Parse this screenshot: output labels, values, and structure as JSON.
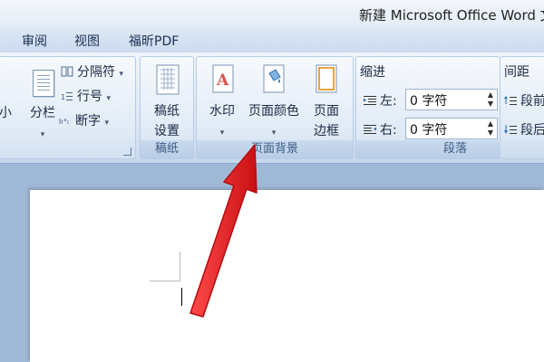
{
  "window": {
    "title": "新建 Microsoft Office Word 文"
  },
  "tabs": [
    {
      "label": "审阅"
    },
    {
      "label": "视图"
    },
    {
      "label": "福昕PDF"
    }
  ],
  "page_setup": {
    "small_label": "小",
    "columns_label": "分栏",
    "breaks_label": "分隔符",
    "line_numbers_label": "行号",
    "hyphenation_label": "断字"
  },
  "draft_paper": {
    "button_line1": "稿纸",
    "button_line2": "设置",
    "group_label": "稿纸"
  },
  "page_background": {
    "watermark_label": "水印",
    "page_color_label": "页面颜色",
    "page_border_line1": "页面",
    "page_border_line2": "边框",
    "group_label": "页面背景"
  },
  "paragraph": {
    "indent_label": "缩进",
    "left_label": "左:",
    "left_value": "0 字符",
    "right_label": "右:",
    "right_value": "0 字符",
    "group_label": "段落"
  },
  "spacing": {
    "label": "间距",
    "before_label": "段前",
    "after_label": "段后"
  },
  "colors": {
    "ribbon": "#dfe9f5",
    "doc_background": "#9fb8d6",
    "annotation_arrow": "#e3161a"
  }
}
